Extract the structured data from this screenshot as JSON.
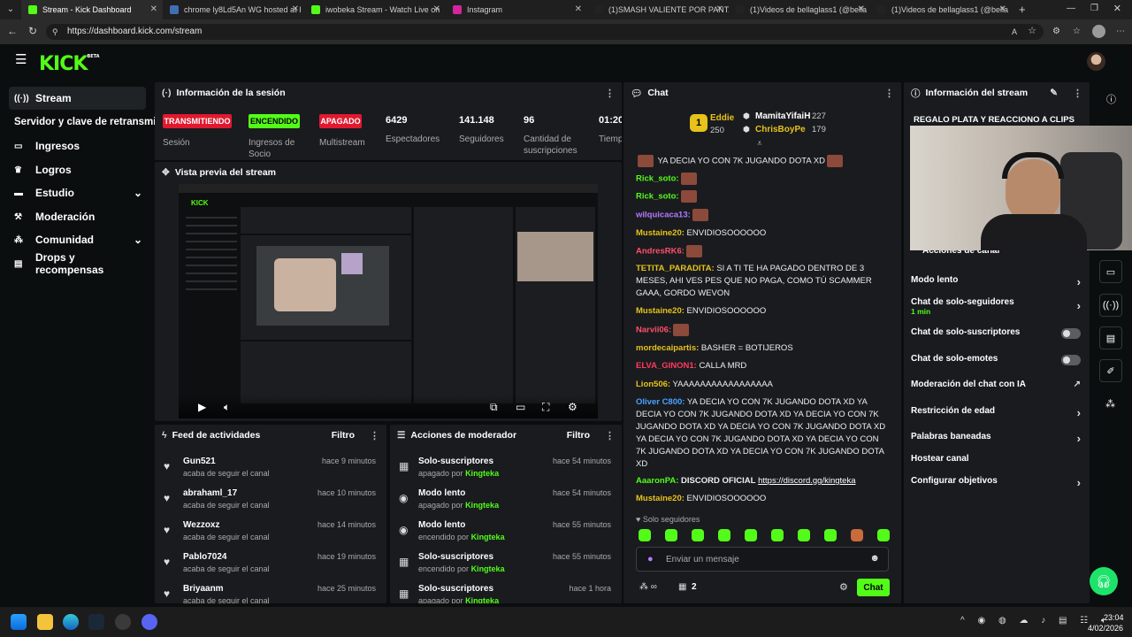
{
  "browser": {
    "tabs": [
      {
        "title": "Stream - Kick Dashboard",
        "color": "#53fc18",
        "active": true
      },
      {
        "title": "chrome ly8Ld5An WG hosted at I",
        "color": "#3f6eb5",
        "active": false
      },
      {
        "title": "iwobeka Stream - Watch Live on",
        "color": "#53fc18",
        "active": false
      },
      {
        "title": "Instagram",
        "color": "#d6249f",
        "active": false
      },
      {
        "title": "(1)SMASH VALIENTE POR PANTA",
        "color": "#222222",
        "active": false
      },
      {
        "title": "(1)Videos de bellaglass1 (@bella",
        "color": "#222222",
        "active": false
      },
      {
        "title": "(1)Videos de bellaglass1 (@bella",
        "color": "#222222",
        "active": false
      }
    ],
    "url": "https://dashboard.kick.com/stream"
  },
  "app": {
    "logo": "KICK",
    "logo_badge": "BETA",
    "accent": "#53fc18"
  },
  "sidebar": {
    "items": [
      {
        "label": "Stream",
        "icon": "broadcast-icon"
      },
      {
        "label": "Servidor y clave de retransmisión",
        "icon": ""
      },
      {
        "label": "Ingresos",
        "icon": "money-icon"
      },
      {
        "label": "Logros",
        "icon": "trophy-icon"
      },
      {
        "label": "Estudio",
        "icon": "studio-icon",
        "chevron": true
      },
      {
        "label": "Moderación",
        "icon": "hammer-icon"
      },
      {
        "label": "Comunidad",
        "icon": "community-icon",
        "chevron": true
      },
      {
        "label": "Drops y recompensas",
        "icon": "drops-icon"
      }
    ]
  },
  "session": {
    "title": "Información de la sesión",
    "badges": [
      {
        "text": "TRANSMITIENDO",
        "label": "Sesión",
        "color": "#e0192f"
      },
      {
        "text": "ENCENDIDO",
        "label": "Ingresos de Socio",
        "color": "#53fc18"
      },
      {
        "text": "APAGADO",
        "label": "Multistream",
        "color": "#e0192f"
      }
    ],
    "stats": [
      {
        "value": "6429",
        "label": "Espectadores"
      },
      {
        "value": "141.148",
        "label": "Seguidores"
      },
      {
        "value": "96",
        "label": "Cantidad de suscripciones"
      },
      {
        "value": "01:20",
        "label": "Tiempo en vivo"
      }
    ]
  },
  "preview": {
    "title": "Vista previa del stream"
  },
  "activity": {
    "title": "Feed de actividades",
    "filter": "Filtro",
    "items": [
      {
        "name": "Gun521",
        "sub": "acaba de seguir el canal",
        "time": "hace 9 minutos"
      },
      {
        "name": "abrahaml_17",
        "sub": "acaba de seguir el canal",
        "time": "hace 10 minutos"
      },
      {
        "name": "Wezzoxz",
        "sub": "acaba de seguir el canal",
        "time": "hace 14 minutos"
      },
      {
        "name": "Pablo7024",
        "sub": "acaba de seguir el canal",
        "time": "hace 19 minutos"
      },
      {
        "name": "Briyaanm",
        "sub": "acaba de seguir el canal",
        "time": "hace 25 minutos"
      }
    ]
  },
  "modactions": {
    "title": "Acciones de moderador",
    "filter": "Filtro",
    "by": "Kingteka",
    "items": [
      {
        "name": "Solo-suscriptores",
        "sub": "apagado por",
        "time": "hace 54 minutos",
        "icon": "gift-icon"
      },
      {
        "name": "Modo lento",
        "sub": "apagado por",
        "time": "hace 54 minutos",
        "icon": "snail-icon"
      },
      {
        "name": "Modo lento",
        "sub": "encendido por",
        "time": "hace 55 minutos",
        "icon": "snail-icon"
      },
      {
        "name": "Solo-suscriptores",
        "sub": "encendido por",
        "time": "hace 55 minutos",
        "icon": "gift-icon"
      },
      {
        "name": "Solo-suscriptores",
        "sub": "apagado por",
        "time": "hace 1 hora",
        "icon": "gift-icon"
      }
    ]
  },
  "chat": {
    "title": "Chat",
    "top": [
      {
        "name": "Eddie",
        "count": "250",
        "color": "#e6c21a"
      },
      {
        "name": "MamitaYifaiH",
        "count": "227",
        "color": "#ffffff"
      },
      {
        "name": "ChrisBoyPe",
        "count": "179",
        "color": "#e6c21a"
      }
    ],
    "messages": [
      {
        "user": "",
        "color": "#53fc18",
        "text": "YA DECIA YO CON 7K JUGANDO DOTA XD"
      },
      {
        "user": "Rick_soto:",
        "color": "#53fc18",
        "text": ""
      },
      {
        "user": "Rick_soto:",
        "color": "#53fc18",
        "text": ""
      },
      {
        "user": "wilquicaca13:",
        "color": "#b57bff",
        "text": ""
      },
      {
        "user": "Mustaine20:",
        "color": "#e6c21a",
        "text": "ENVIDIOSOOOOOO"
      },
      {
        "user": "AndresRK6:",
        "color": "#ff4f6a",
        "text": ""
      },
      {
        "user": "TETITA_PARADITA:",
        "color": "#e6c21a",
        "text": "SI A TI TE HA PAGADO DENTRO DE 3 MESES, AHI VES PES QUE NO PAGA, COMO TÚ SCAMMER GAAA, GORDO WEVON"
      },
      {
        "user": "Mustaine20:",
        "color": "#e6c21a",
        "text": "ENVIDIOSOOOOOO"
      },
      {
        "user": "Narvii06:",
        "color": "#ff4f6a",
        "text": ""
      },
      {
        "user": "mordecaipartis:",
        "color": "#e6c21a",
        "text": "BASHER = BOTIJEROS"
      },
      {
        "user": "ELVA_GINON1:",
        "color": "#ff3b5c",
        "text": "CALLA MRD"
      },
      {
        "user": "Lion506:",
        "color": "#e6c21a",
        "text": "YAAAAAAAAAAAAAAAAA"
      },
      {
        "user": "Oliver C800:",
        "color": "#4aa3ff",
        "text": "YA DECIA YO CON 7K JUGANDO DOTA XD YA DECIA YO CON 7K JUGANDO DOTA XD YA DECIA YO CON 7K JUGANDO DOTA XD YA DECIA YO CON 7K JUGANDO DOTA XD YA DECIA YO CON 7K JUGANDO DOTA XD YA DECIA YO CON 7K JUGANDO DOTA XD YA DECIA YO CON 7K JUGANDO DOTA XD"
      },
      {
        "user": "AaaronPA:",
        "color": "#53fc18",
        "text": "DISCORD OFICIAL",
        "link": "https://discord.gg/kingteka"
      },
      {
        "user": "Mustaine20:",
        "color": "#e6c21a",
        "text": "ENVIDIOSOOOOOO"
      }
    ],
    "mode": "Solo seguidores",
    "placeholder": "Enviar un mensaje",
    "count": "2",
    "send": "Chat"
  },
  "streaminfo": {
    "title": "Información del stream",
    "stream_title": "REGALO PLATA Y REACCIONO A CLIPS",
    "actions_title": "Acciones de canal",
    "settings": [
      {
        "label": "Modo lento",
        "type": "chevron"
      },
      {
        "label": "Chat de solo-seguidores",
        "sub": "1 min",
        "type": "chevron"
      },
      {
        "label": "Chat de solo-suscriptores",
        "type": "toggle"
      },
      {
        "label": "Chat de solo-emotes",
        "type": "toggle"
      },
      {
        "label": "Moderación del chat con IA",
        "type": "external"
      },
      {
        "label": "Restricción de edad",
        "type": "chevron"
      },
      {
        "label": "Palabras baneadas",
        "type": "chevron"
      },
      {
        "label": "Hostear canal",
        "type": "none"
      },
      {
        "label": "Configurar objetivos",
        "type": "chevron"
      }
    ]
  },
  "taskbar": {
    "time": "23:04",
    "date": "4/02/2026"
  }
}
